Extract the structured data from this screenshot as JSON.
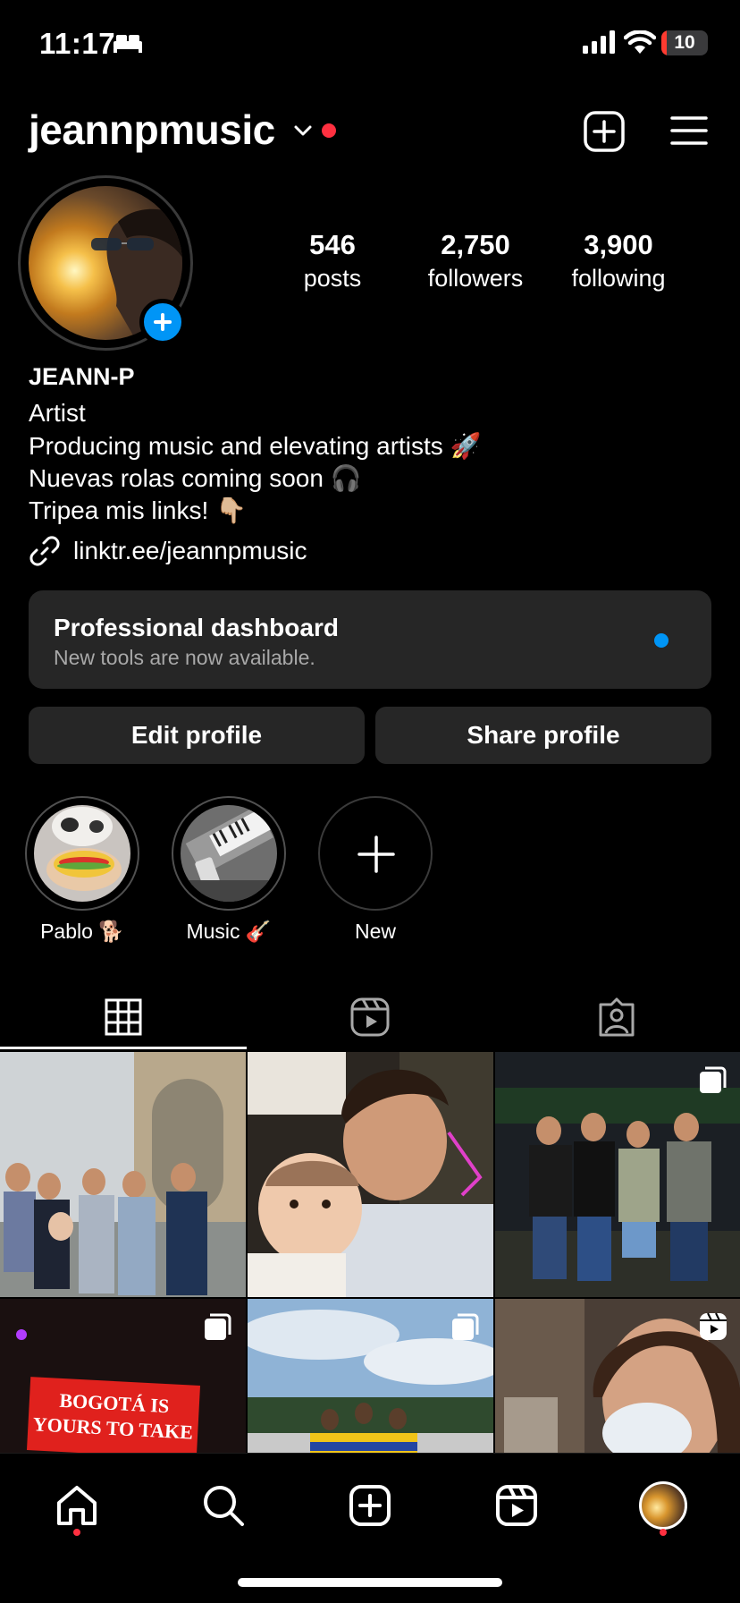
{
  "status_bar": {
    "time": "11:17",
    "battery": "10"
  },
  "header": {
    "username": "jeannpmusic"
  },
  "stats": [
    {
      "value": "546",
      "label": "posts"
    },
    {
      "value": "2,750",
      "label": "followers"
    },
    {
      "value": "3,900",
      "label": "following"
    }
  ],
  "bio": {
    "name": "JEANN-P",
    "category": "Artist",
    "lines": [
      "Producing music and elevating artists 🚀",
      "Nuevas rolas coming soon 🎧",
      "Tripea mis links! 👇🏼"
    ],
    "link": "linktr.ee/jeannpmusic"
  },
  "dashboard": {
    "title": "Professional dashboard",
    "subtitle": "New tools are now available."
  },
  "buttons": {
    "edit": "Edit profile",
    "share": "Share profile"
  },
  "highlights": [
    {
      "label": "Pablo 🐕"
    },
    {
      "label": "Music 🎸"
    },
    {
      "label": "New"
    }
  ],
  "tabs": [
    "grid-icon",
    "reels-icon",
    "tagged-icon"
  ],
  "nav": [
    "home-icon",
    "search-icon",
    "create-icon",
    "reels-icon",
    "profile-avatar"
  ],
  "colors": {
    "accent": "#0095f6",
    "notification": "#ff3040",
    "surface": "#262626"
  }
}
